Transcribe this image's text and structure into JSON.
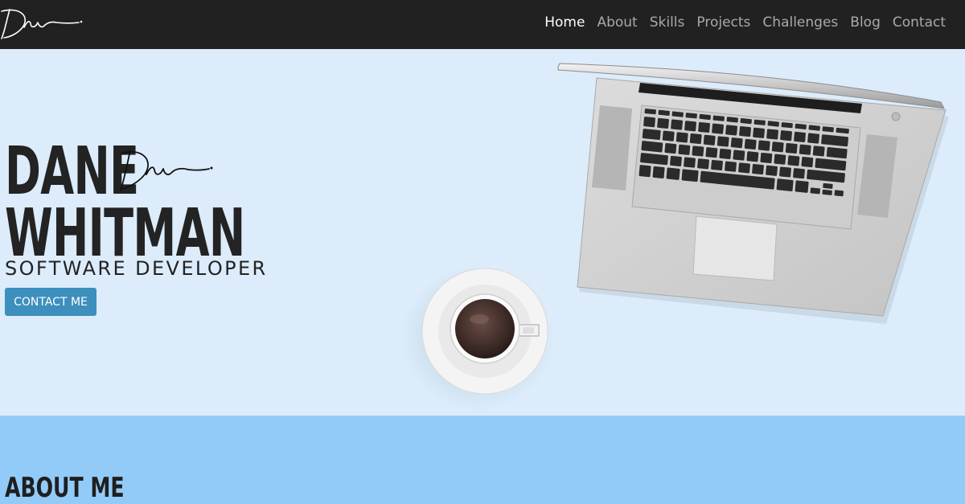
{
  "nav": {
    "links": [
      {
        "label": "Home",
        "active": true
      },
      {
        "label": "About"
      },
      {
        "label": "Skills"
      },
      {
        "label": "Projects"
      },
      {
        "label": "Challenges"
      },
      {
        "label": "Blog"
      },
      {
        "label": "Contact"
      }
    ]
  },
  "hero": {
    "first_name": "DANE",
    "last_name": "WHITMAN",
    "subtitle": "SOFTWARE DEVELOPER",
    "cta_label": "CONTACT ME"
  },
  "about": {
    "heading": "ABOUT ME"
  },
  "colors": {
    "navbar": "#212121",
    "hero_bg": "#dcecfa",
    "about_bg": "#92cbf8",
    "button": "#3d8fbd"
  }
}
